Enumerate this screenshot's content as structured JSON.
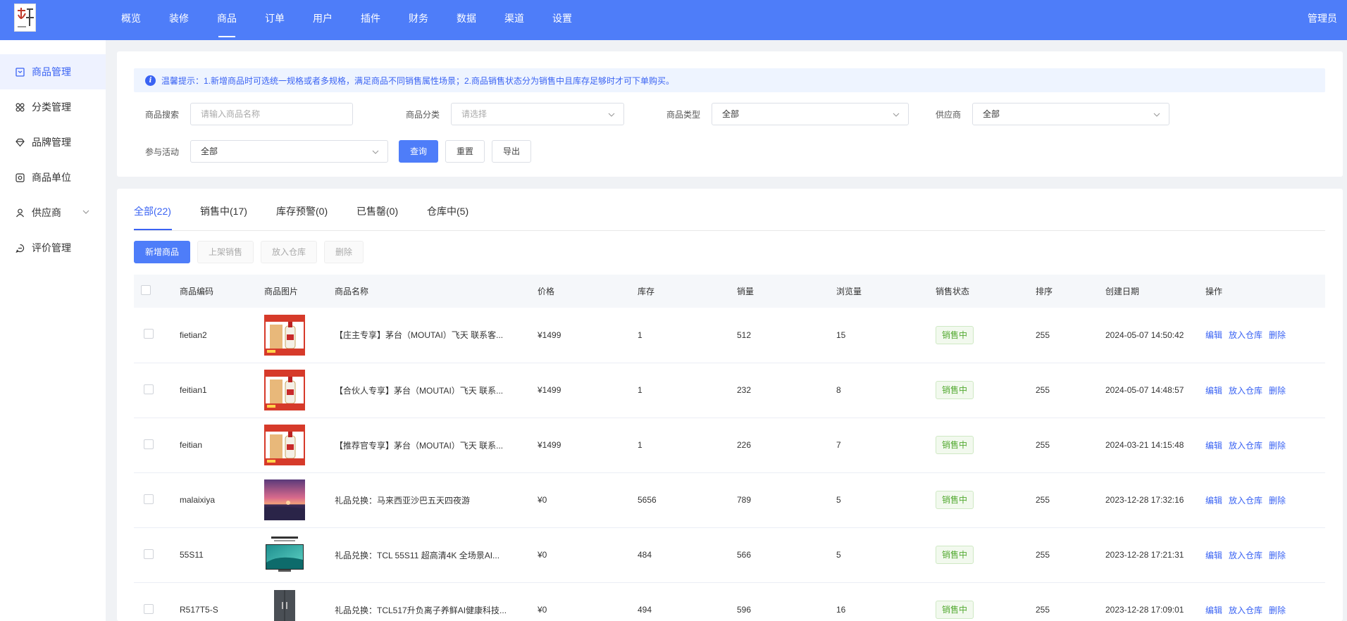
{
  "header": {
    "nav": [
      "概览",
      "装修",
      "商品",
      "订单",
      "用户",
      "插件",
      "财务",
      "数据",
      "渠道",
      "设置"
    ],
    "active_index": 2,
    "user": "管理员"
  },
  "sidebar": {
    "items": [
      {
        "label": "商品管理",
        "icon": "box-icon",
        "active": true
      },
      {
        "label": "分类管理",
        "icon": "category-icon",
        "active": false
      },
      {
        "label": "品牌管理",
        "icon": "diamond-icon",
        "active": false
      },
      {
        "label": "商品单位",
        "icon": "unit-icon",
        "active": false
      },
      {
        "label": "供应商",
        "icon": "user-icon",
        "active": false,
        "expandable": true
      },
      {
        "label": "评价管理",
        "icon": "comment-icon",
        "active": false
      }
    ]
  },
  "tip": {
    "text": "温馨提示：1.新增商品时可选统一规格或者多规格，满足商品不同销售属性场景；2.商品销售状态分为销售中且库存足够时才可下单购买。"
  },
  "filters": {
    "search_label": "商品搜索",
    "search_placeholder": "请输入商品名称",
    "category_label": "商品分类",
    "category_placeholder": "请选择",
    "type_label": "商品类型",
    "type_value": "全部",
    "supplier_label": "供应商",
    "supplier_value": "全部",
    "activity_label": "参与活动",
    "activity_value": "全部",
    "query_btn": "查询",
    "reset_btn": "重置",
    "export_btn": "导出"
  },
  "tabs": [
    "全部(22)",
    "销售中(17)",
    "库存预警(0)",
    "已售罄(0)",
    "仓库中(5)"
  ],
  "actions": {
    "add": "新增商品",
    "on_sale": "上架销售",
    "to_warehouse": "放入仓库",
    "delete": "删除"
  },
  "table": {
    "headers": [
      "商品编码",
      "商品图片",
      "商品名称",
      "价格",
      "库存",
      "销量",
      "浏览量",
      "销售状态",
      "排序",
      "创建日期",
      "操作"
    ],
    "row_actions": [
      "编辑",
      "放入仓库",
      "删除"
    ],
    "rows": [
      {
        "code": "fietian2",
        "image": "moutai",
        "name": "【庄主专享】茅台（MOUTAI）飞天 联系客...",
        "price": "¥1499",
        "stock": "1",
        "sales": "512",
        "views": "15",
        "status": "销售中",
        "sort": "255",
        "created": "2024-05-07 14:50:42"
      },
      {
        "code": "feitian1",
        "image": "moutai",
        "name": "【合伙人专享】茅台（MOUTAI）飞天 联系...",
        "price": "¥1499",
        "stock": "1",
        "sales": "232",
        "views": "8",
        "status": "销售中",
        "sort": "255",
        "created": "2024-05-07 14:48:57"
      },
      {
        "code": "feitian",
        "image": "moutai",
        "name": "【推荐官专享】茅台（MOUTAI）飞天 联系...",
        "price": "¥1499",
        "stock": "1",
        "sales": "226",
        "views": "7",
        "status": "销售中",
        "sort": "255",
        "created": "2024-03-21 14:15:48"
      },
      {
        "code": "malaixiya",
        "image": "sunset",
        "name": "礼品兑换：马来西亚沙巴五天四夜游",
        "price": "¥0",
        "stock": "5656",
        "sales": "789",
        "views": "5",
        "status": "销售中",
        "sort": "255",
        "created": "2023-12-28 17:32:16"
      },
      {
        "code": "55S11",
        "image": "tv",
        "name": "礼品兑换：TCL 55S11 超高清4K 全场景AI...",
        "price": "¥0",
        "stock": "484",
        "sales": "566",
        "views": "5",
        "status": "销售中",
        "sort": "255",
        "created": "2023-12-28 17:21:31"
      },
      {
        "code": "R517T5-S",
        "image": "fridge",
        "name": "礼品兑换：TCL517升负离子养鲜AI健康科技...",
        "price": "¥0",
        "stock": "494",
        "sales": "596",
        "views": "16",
        "status": "销售中",
        "sort": "255",
        "created": "2023-12-28 17:09:01"
      }
    ]
  }
}
